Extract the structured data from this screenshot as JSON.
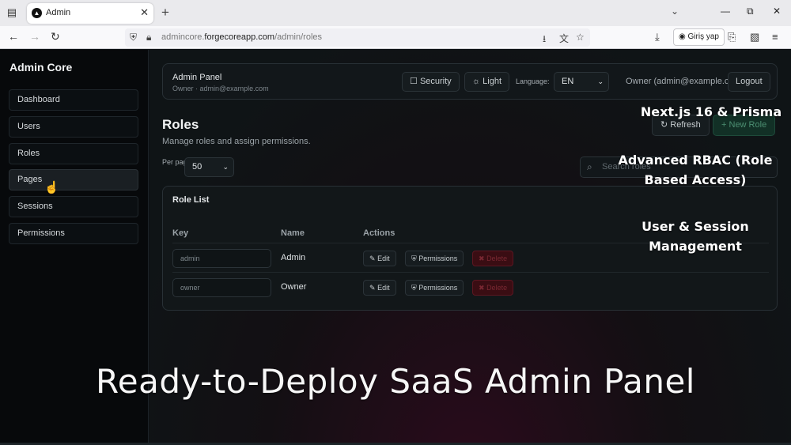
{
  "browser": {
    "tab_title": "Admin",
    "url_prefix": "admincore.",
    "url_domain": "forgecoreapp.com",
    "url_path": "/admin/roles",
    "signin_label": "Giriş yap"
  },
  "sidebar": {
    "brand": "Admin Core",
    "items": [
      {
        "label": "Dashboard"
      },
      {
        "label": "Users"
      },
      {
        "label": "Roles"
      },
      {
        "label": "Pages"
      },
      {
        "label": "Sessions"
      },
      {
        "label": "Permissions"
      }
    ]
  },
  "header": {
    "title": "Admin Panel",
    "subtitle": "Owner · admin@example.com",
    "security_label": "Security",
    "theme_label": "Light",
    "language_label": "Language:",
    "language_value": "EN",
    "owner_text": "Owner (admin@example.com)",
    "logout_label": "Logout"
  },
  "page": {
    "title": "Roles",
    "subtitle": "Manage roles and assign permissions.",
    "refresh_label": "Refresh",
    "new_role_label": "New Role",
    "per_page_label": "Per page",
    "per_page_value": "50",
    "search_placeholder": "Search roles"
  },
  "role_list": {
    "title": "Role List",
    "columns": [
      "Key",
      "Name",
      "Actions"
    ],
    "rows": [
      {
        "key": "admin",
        "name": "Admin"
      },
      {
        "key": "owner",
        "name": "Owner"
      }
    ],
    "edit_label": "Edit",
    "permissions_label": "Permissions",
    "delete_label": "Delete"
  },
  "overlay": {
    "feature_1": "Next.js 16 & Prisma",
    "feature_2": "Advanced RBAC (Role Based Access)",
    "feature_3": "User & Session Management",
    "headline": "Ready-to-Deploy SaaS Admin Panel"
  },
  "colors": {
    "background": "#0d1114",
    "sidebar": "#07090b",
    "accent_green": "#123026",
    "danger": "#3a0d13"
  }
}
